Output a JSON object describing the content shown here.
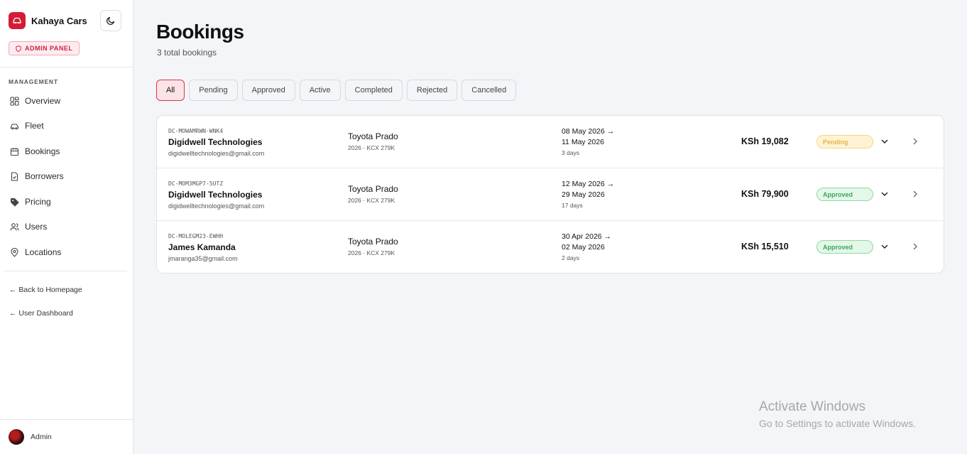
{
  "brand": {
    "name": "Kahaya Cars",
    "badge": "ADMIN PANEL"
  },
  "sidebar": {
    "section_label": "MANAGEMENT",
    "items": [
      {
        "label": "Overview",
        "icon": "grid-icon"
      },
      {
        "label": "Fleet",
        "icon": "car-icon"
      },
      {
        "label": "Bookings",
        "icon": "calendar-icon"
      },
      {
        "label": "Borrowers",
        "icon": "document-check-icon"
      },
      {
        "label": "Pricing",
        "icon": "tag-icon"
      },
      {
        "label": "Users",
        "icon": "users-icon"
      },
      {
        "label": "Locations",
        "icon": "map-pin-icon"
      }
    ],
    "links": [
      {
        "label": "← Back to Homepage"
      },
      {
        "label": "← User Dashboard"
      }
    ],
    "user": {
      "name": "Admin"
    }
  },
  "main": {
    "title": "Bookings",
    "subtitle": "3 total bookings",
    "filters": [
      "All",
      "Pending",
      "Approved",
      "Active",
      "Completed",
      "Rejected",
      "Cancelled"
    ],
    "active_filter": "All",
    "bookings": [
      {
        "ref": "DC-MOWAMRWN-WNK4",
        "customer": "Digidwell Technologies",
        "email": "digidwelltechnologies@gmail.com",
        "car": "Toyota Prado",
        "car_meta": "2026 · KCX 279K",
        "start": "08 May 2026 →",
        "end": "11 May 2026",
        "days": "3 days",
        "price": "KSh 19,082",
        "status": "Pending"
      },
      {
        "ref": "DC-MOM3MGP7-5UTZ",
        "customer": "Digidwell Technologies",
        "email": "digidwelltechnologies@gmail.com",
        "car": "Toyota Prado",
        "car_meta": "2026 · KCX 279K",
        "start": "12 May 2026 →",
        "end": "29 May 2026",
        "days": "17 days",
        "price": "KSh 79,900",
        "status": "Approved"
      },
      {
        "ref": "DC-MOLEGM23-EWHH",
        "customer": "James Kamanda",
        "email": "jmaranga35@gmail.com",
        "car": "Toyota Prado",
        "car_meta": "2026 · KCX 279K",
        "start": "30 Apr 2026 →",
        "end": "02 May 2026",
        "days": "2 days",
        "price": "KSh 15,510",
        "status": "Approved"
      }
    ]
  },
  "watermark": {
    "line1": "Activate Windows",
    "line2": "Go to Settings to activate Windows."
  },
  "colors": {
    "accent": "#d41c36",
    "pending": "#e5b54a",
    "approved": "#3aa85b"
  }
}
